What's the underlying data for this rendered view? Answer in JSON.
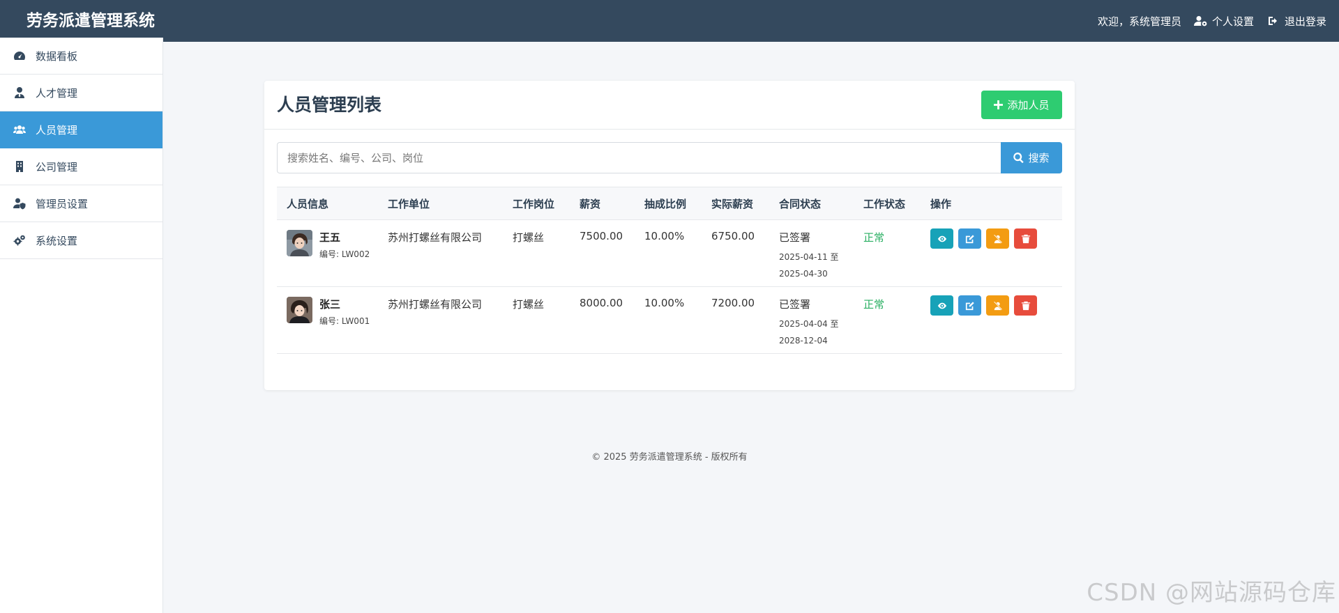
{
  "app": {
    "title": "劳务派遣管理系统",
    "welcome": "欢迎，系统管理员",
    "profile_label": "个人设置",
    "logout_label": "退出登录"
  },
  "sidebar": {
    "items": [
      {
        "label": "数据看板",
        "icon": "dashboard-icon",
        "active": false
      },
      {
        "label": "人才管理",
        "icon": "user-tie-icon",
        "active": false
      },
      {
        "label": "人员管理",
        "icon": "users-icon",
        "active": true
      },
      {
        "label": "公司管理",
        "icon": "building-icon",
        "active": false
      },
      {
        "label": "管理员设置",
        "icon": "user-shield-icon",
        "active": false
      },
      {
        "label": "系统设置",
        "icon": "cogs-icon",
        "active": false
      }
    ]
  },
  "main": {
    "title": "人员管理列表",
    "add_button": "添加人员",
    "search_placeholder": "搜索姓名、编号、公司、岗位",
    "search_button": "搜索",
    "columns": [
      "人员信息",
      "工作单位",
      "工作岗位",
      "薪资",
      "抽成比例",
      "实际薪资",
      "合同状态",
      "工作状态",
      "操作"
    ],
    "rows": [
      {
        "name": "王五",
        "code": "编号: LW002",
        "company": "苏州打螺丝有限公司",
        "position": "打螺丝",
        "salary": "7500.00",
        "commission": "10.00%",
        "actual": "6750.00",
        "contract": "已签署",
        "contract_start": "2025-04-11 至",
        "contract_end": "2025-04-30",
        "work_status": "正常"
      },
      {
        "name": "张三",
        "code": "编号: LW001",
        "company": "苏州打螺丝有限公司",
        "position": "打螺丝",
        "salary": "8000.00",
        "commission": "10.00%",
        "actual": "7200.00",
        "contract": "已签署",
        "contract_start": "2025-04-04 至",
        "contract_end": "2028-12-04",
        "work_status": "正常"
      }
    ]
  },
  "footer": "© 2025 劳务派遣管理系统 - 版权所有",
  "watermark": "CSDN @网站源码仓库",
  "colors": {
    "topbar": "#34495e",
    "active": "#3a99d8",
    "success": "#2ecc71",
    "view": "#17a2b8",
    "warning": "#f39c12",
    "danger": "#e74c3c"
  }
}
